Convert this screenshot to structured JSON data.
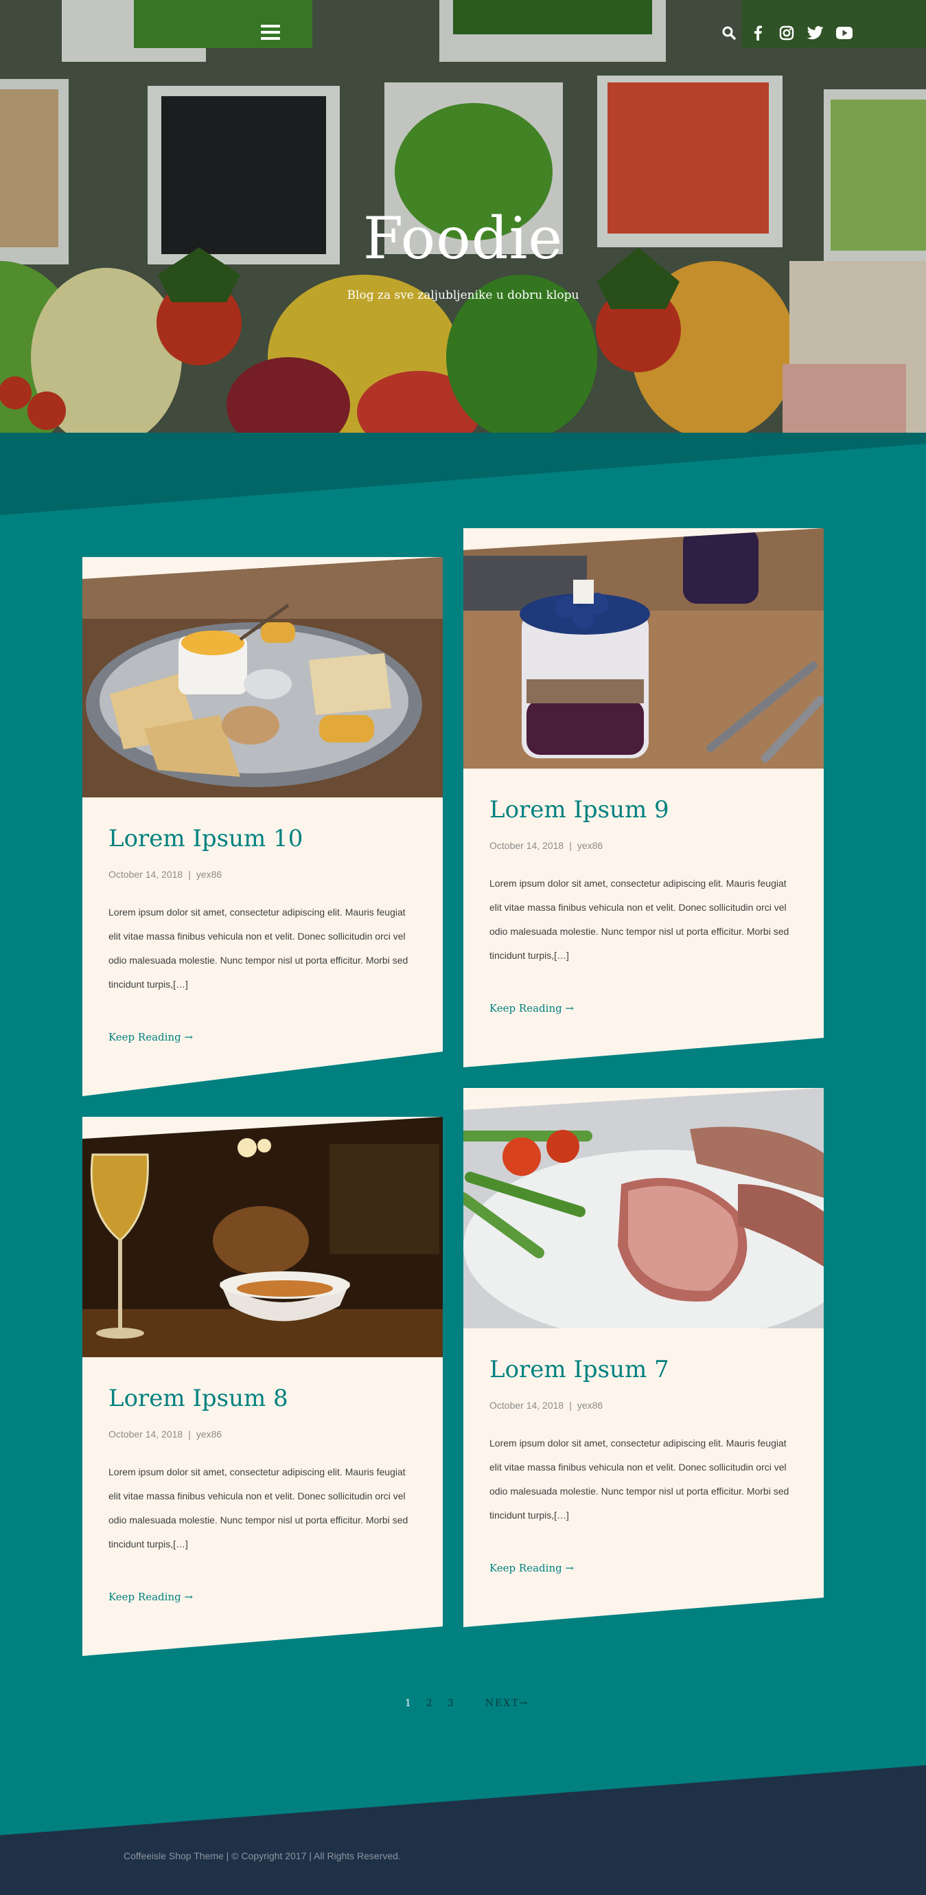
{
  "header": {
    "site_title": "Foodie",
    "tagline": "Blog za sve zaljubljenike u dobru klopu",
    "icons": [
      "menu-icon",
      "search-icon",
      "facebook-icon",
      "instagram-icon",
      "twitter-icon",
      "youtube-icon"
    ]
  },
  "posts": [
    {
      "title": "Lorem Ipsum 10",
      "date": "October 14, 2018",
      "separator": "|",
      "author": "yex86",
      "excerpt": "Lorem ipsum dolor sit amet, consectetur adipiscing elit. Mauris feugiat elit vitae massa finibus vehicula non et velit. Donec sollicitudin orci vel odio malesuada molestie. Nunc tempor nisl ut porta efficitur. Morbi sed tincidunt turpis,[…]",
      "more": "Keep Reading →",
      "image": "nachos-platter"
    },
    {
      "title": "Lorem Ipsum 9",
      "date": "October 14, 2018",
      "separator": "|",
      "author": "yex86",
      "excerpt": "Lorem ipsum dolor sit amet, consectetur adipiscing elit. Mauris feugiat elit vitae massa finibus vehicula non et velit. Donec sollicitudin orci vel odio malesuada molestie. Nunc tempor nisl ut porta efficitur. Morbi sed tincidunt turpis,[…]",
      "more": "Keep Reading →",
      "image": "blueberry-parfait"
    },
    {
      "title": "Lorem Ipsum 8",
      "date": "October 14, 2018",
      "separator": "|",
      "author": "yex86",
      "excerpt": "Lorem ipsum dolor sit amet, consectetur adipiscing elit. Mauris feugiat elit vitae massa finibus vehicula non et velit. Donec sollicitudin orci vel odio malesuada molestie. Nunc tempor nisl ut porta efficitur. Morbi sed tincidunt turpis,[…]",
      "more": "Keep Reading →",
      "image": "wine-and-bowl"
    },
    {
      "title": "Lorem Ipsum 7",
      "date": "October 14, 2018",
      "separator": "|",
      "author": "yex86",
      "excerpt": "Lorem ipsum dolor sit amet, consectetur adipiscing elit. Mauris feugiat elit vitae massa finibus vehicula non et velit. Donec sollicitudin orci vel odio malesuada molestie. Nunc tempor nisl ut porta efficitur. Morbi sed tincidunt turpis,[…]",
      "more": "Keep Reading →",
      "image": "steak-asparagus"
    }
  ],
  "pagination": {
    "pages": [
      "1",
      "2",
      "3"
    ],
    "current": "1",
    "next": "NEXT→"
  },
  "footer": {
    "text": "Coffeeisle Shop Theme | © Copyright 2017 | All Rights Reserved."
  },
  "colors": {
    "teal": "#018080",
    "dark_teal": "#026666",
    "card_bg": "#fdf5eb",
    "footer_navy": "#1f3146"
  }
}
